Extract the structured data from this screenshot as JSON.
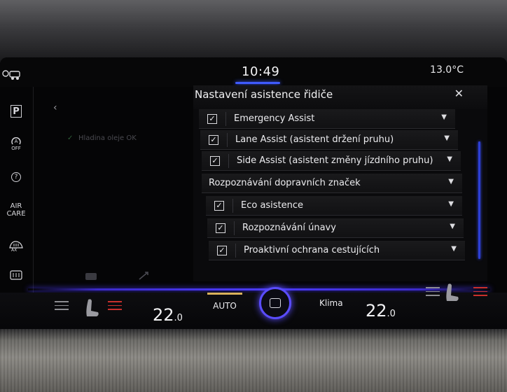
{
  "status_bar": {
    "clock": "10:49",
    "outside_temp": "13.0°C",
    "left_icon": "driver-assist-icon"
  },
  "left_nav": {
    "items": [
      {
        "icon": "parking-icon",
        "label": "P"
      },
      {
        "icon": "auto-hold-off-icon",
        "label": "OFF"
      },
      {
        "icon": "help-icon",
        "label": "?"
      },
      {
        "icon": "air-care-icon",
        "label_line1": "AIR",
        "label_line2": "CARE"
      },
      {
        "icon": "max-defrost-icon",
        "label": "AX"
      },
      {
        "icon": "rear-defrost-icon"
      }
    ]
  },
  "background_page": {
    "back_icon": "chevron-left-icon",
    "item_text": "Hladina oleje OK"
  },
  "dialog": {
    "title": "Nastavení asistence řidiče",
    "close_icon": "close-icon",
    "rows": [
      {
        "label": "Emergency Assist",
        "checked": true
      },
      {
        "label": "Lane Assist (asistent držení pruhu)",
        "checked": true
      },
      {
        "label": "Side Assist (asistent změny jízdního pruhu)",
        "checked": true
      },
      {
        "label": "Rozpoznávání dopravních značek",
        "header": true
      },
      {
        "label": "Eco asistence",
        "checked": true
      },
      {
        "label": "Rozpoznávání únavy",
        "checked": true
      },
      {
        "label": "Proaktivní ochrana cestujících",
        "checked": true
      }
    ]
  },
  "climate": {
    "left_temp": "22",
    "left_temp_decimal": ".0",
    "auto_label": "AUTO",
    "klima_label": "Klima",
    "right_temp": "22",
    "right_temp_decimal": ".0",
    "accent_color": "#4b3bff",
    "auto_indicator_color": "#d9b15a"
  }
}
